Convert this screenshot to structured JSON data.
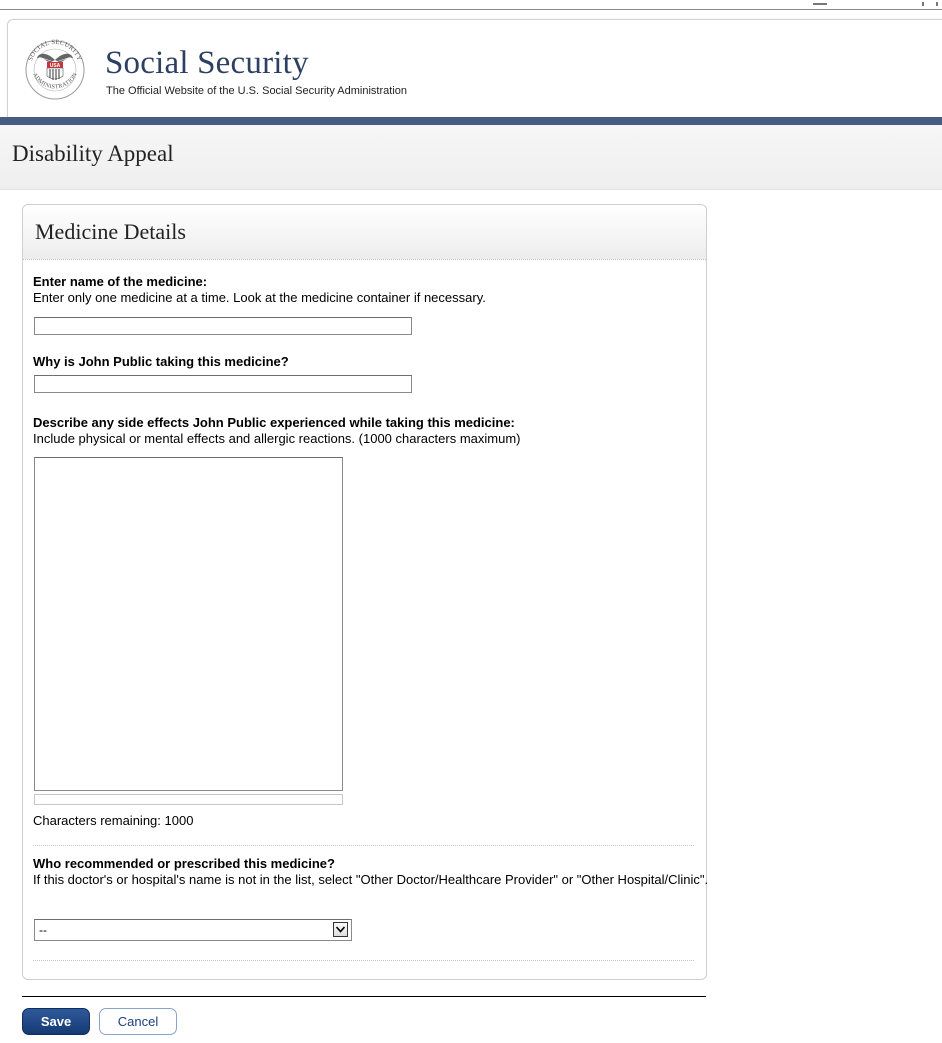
{
  "header": {
    "title": "Social Security",
    "subtitle": "The Official Website of the U.S. Social Security Administration",
    "seal": {
      "icon": "ssa-seal-icon",
      "ring_text_top": "SOCIAL SECURITY",
      "ring_text_bottom": "ADMINISTRATION",
      "center_text": "USA"
    }
  },
  "page": {
    "title": "Disability Appeal"
  },
  "panel": {
    "title": "Medicine Details",
    "medicine_name": {
      "label": "Enter name of the medicine:",
      "help": "Enter only one medicine at a time. Look at the medicine container if necessary.",
      "value": ""
    },
    "reason": {
      "label": "Why is John Public taking this medicine?",
      "value": ""
    },
    "side_effects": {
      "label": "Describe any side effects John Public experienced while taking this medicine:",
      "help": "Include physical or mental effects and allergic reactions. (1000 characters maximum)",
      "value": "",
      "remaining_label": "Characters remaining:",
      "remaining": "1000"
    },
    "prescriber": {
      "label": "Who recommended or prescribed this medicine?",
      "help": "If this doctor's or hospital's name is not in the list, select \"Other Doctor/Healthcare Provider\" or \"Other Hospital/Clinic\".",
      "selected": "--",
      "icon": "chevron-down-icon"
    }
  },
  "actions": {
    "save": "Save",
    "cancel": "Cancel"
  },
  "colors": {
    "brand_blue": "#455c85",
    "title_blue": "#2d3f63",
    "save_button": "#1e4483"
  }
}
